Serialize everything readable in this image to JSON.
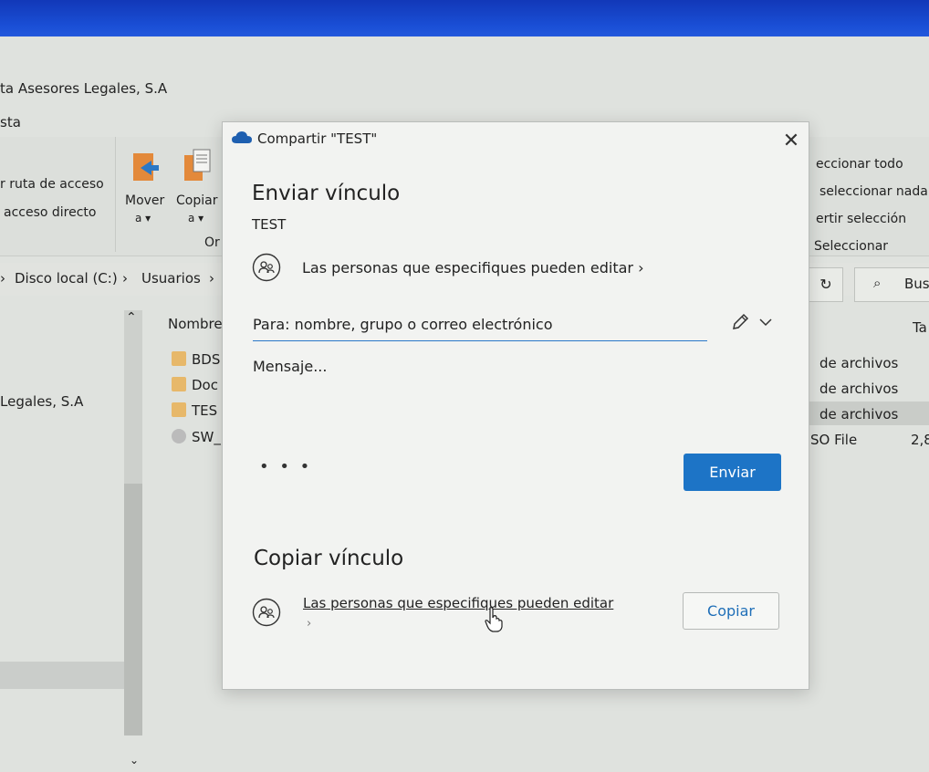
{
  "explorer": {
    "window_title": "ta Asesores Legales, S.A",
    "tab_fragment": "sta",
    "ribbon": {
      "path_copy": "r ruta de acceso",
      "shortcut": "acceso directo",
      "move_label": "Mover",
      "move_sub": "a ▾",
      "copy_label": "Copiar",
      "copy_sub": "a ▾",
      "organize_fragment": "Or",
      "select_all": "eccionar todo",
      "select_none": "seleccionar nada",
      "invert": "ertir selección",
      "select_group": "Seleccionar"
    },
    "address": {
      "drive": "Disco local (C:)",
      "users": "Usuarios",
      "search_placeholder": "Bus"
    },
    "left_pane_item": "Legales, S.A",
    "columns": {
      "name": "Nombre",
      "size_fragment": "Ta"
    },
    "files": [
      {
        "name": "BDS",
        "type": "de archivos"
      },
      {
        "name": "Doc",
        "type": "de archivos"
      },
      {
        "name": "TES",
        "type": "de archivos"
      },
      {
        "name": "SW_",
        "type": "SO File",
        "size": "2,8"
      }
    ]
  },
  "dialog": {
    "title": "Compartir \"TEST\"",
    "send_heading": "Enviar vínculo",
    "item_name": "TEST",
    "permission": "Las personas que especifiques pueden editar",
    "to_placeholder": "Para: nombre, grupo o correo electrónico",
    "message_placeholder": "Mensaje...",
    "more": "• • •",
    "send_label": "Enviar",
    "copy_heading": "Copiar vínculo",
    "copy_permission": "Las personas que especifiques pueden editar",
    "copy_label": "Copiar"
  },
  "colors": {
    "accent": "#1d74c6",
    "cloud": "#1e5fb0"
  }
}
